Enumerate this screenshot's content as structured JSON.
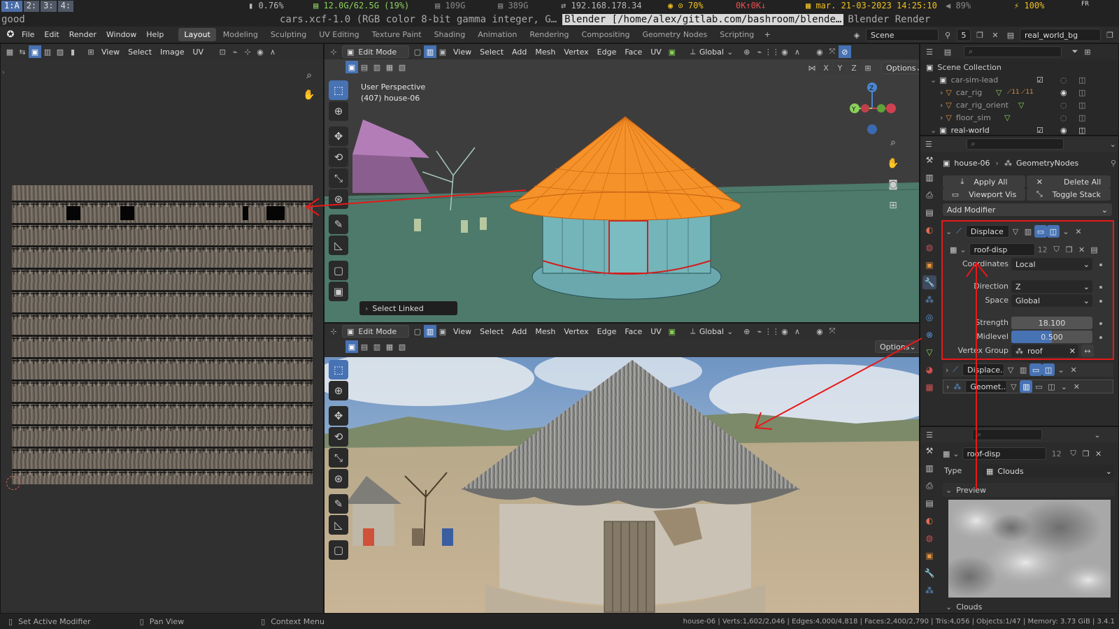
{
  "sysbar": {
    "workspaces": [
      "1:A",
      "2:",
      "3:",
      "4:"
    ],
    "cpu": "0.76%",
    "mem": "12.0G/62.5G (19%)",
    "disk1": "109G",
    "disk2": "389G",
    "ip": "192.168.178.34",
    "wifi": "70%",
    "net": "0K↑0K↓",
    "date": "mar. 21-03-2023 14:25:10",
    "volume": "89%",
    "battery": "100%",
    "lang": "FR"
  },
  "titlebar": {
    "left": "good",
    "t1": "cars.xcf-1.0 (RGB color 8-bit gamma integer, G…",
    "active": "Blender [/home/alex/gitlab.com/bashroom/blende…",
    "t3": "Blender Render"
  },
  "topbar": {
    "menus": [
      "File",
      "Edit",
      "Render",
      "Window",
      "Help"
    ],
    "workspaces": [
      "Layout",
      "Modeling",
      "Sculpting",
      "UV Editing",
      "Texture Paint",
      "Shading",
      "Animation",
      "Rendering",
      "Compositing",
      "Geometry Nodes",
      "Scripting"
    ],
    "scene": "Scene",
    "scene_count": "5",
    "viewlayer": "real_world_bg"
  },
  "uv_editor": {
    "menus": [
      "View",
      "Select",
      "Image",
      "UV"
    ]
  },
  "viewport": {
    "mode": "Edit Mode",
    "menus": [
      "View",
      "Select",
      "Add",
      "Mesh",
      "Vertex",
      "Edge",
      "Face",
      "UV"
    ],
    "transform": "Global",
    "options": "Options",
    "axes": [
      "X",
      "Y",
      "Z"
    ],
    "overlay_line1": "User Perspective",
    "overlay_line2": "(407) house-06",
    "select_linked": "Select Linked"
  },
  "viewport2": {
    "mode": "Edit Mode",
    "options": "Options"
  },
  "outliner": {
    "root": "Scene Collection",
    "items": [
      {
        "name": "car-sim-lead",
        "level": 1
      },
      {
        "name": "car_rig",
        "level": 2
      },
      {
        "name": "car_rig_orient",
        "level": 2
      },
      {
        "name": "floor_sim",
        "level": 2
      },
      {
        "name": "real-world",
        "level": 1
      }
    ],
    "badge1": "11",
    "badge2": "11"
  },
  "modifiers": {
    "object": "house-06",
    "tab": "GeometryNodes",
    "apply_all": "Apply All",
    "delete_all": "Delete All",
    "viewport_vis": "Viewport Vis",
    "toggle_stack": "Toggle Stack",
    "add_modifier": "Add Modifier",
    "displace": {
      "name": "Displace",
      "texture": "roof-disp",
      "texture_users": "12",
      "coordinates_label": "Coordinates",
      "coordinates": "Local",
      "direction_label": "Direction",
      "direction": "Z",
      "space_label": "Space",
      "space": "Global",
      "strength_label": "Strength",
      "strength": "18.100",
      "midlevel_label": "Midlevel",
      "midlevel": "0.500",
      "midlevel_value": 0.5,
      "vgroup_label": "Vertex Group",
      "vgroup": "roof"
    },
    "collapsed": [
      "Displace...",
      "Geomet..."
    ]
  },
  "texture": {
    "name": "roof-disp",
    "users": "12",
    "type_label": "Type",
    "type": "Clouds",
    "preview_label": "Preview",
    "clouds_label": "Clouds"
  },
  "status": {
    "left1": "Set Active Modifier",
    "left2": "Pan View",
    "left3": "Context Menu",
    "right": "house-06 | Verts:1,602/2,046 | Edges:4,000/4,818 | Faces:2,400/2,790 | Tris:4,056 | Objects:1/47 | Memory: 3.73 GiB | 3.4.1"
  },
  "colors": {
    "accent": "#4772b3",
    "roof_select": "#f79226",
    "annotation": "#e81818"
  }
}
